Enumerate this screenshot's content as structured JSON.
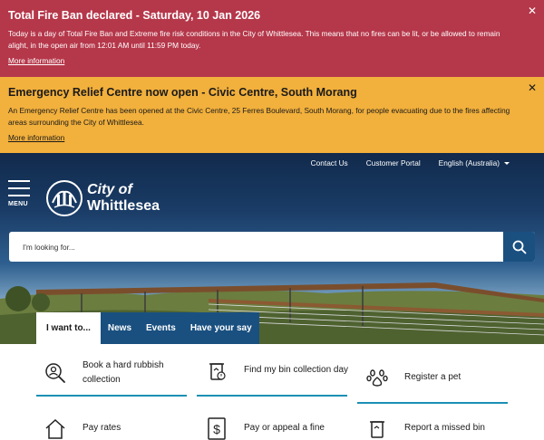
{
  "alerts": {
    "fire_ban": {
      "title": "Total Fire Ban declared - Saturday, 10 Jan 2026",
      "body": "Today is a day of Total Fire Ban and Extreme fire risk conditions in the City of Whittlesea. This means that no fires can be lit, or be allowed to remain alight, in the open air from 12:01 AM until 11:59 PM today.",
      "link": "More information",
      "close": "✕",
      "color": "#b5374a"
    },
    "relief_centre": {
      "title": "Emergency Relief Centre now open - Civic Centre, South Morang",
      "body": "An Emergency Relief Centre has been opened at the Civic Centre, 25 Ferres Boulevard, South Morang, for people evacuating due to the fires affecting areas surrounding the City of Whittlesea.",
      "link": "More information",
      "close": "✕",
      "color": "#f2b03c"
    }
  },
  "utility_nav": {
    "contact": "Contact Us",
    "portal": "Customer Portal",
    "language": "English (Australia)"
  },
  "header": {
    "menu_label": "MENU",
    "logo_line1": "City of",
    "logo_line2": "Whittlesea"
  },
  "search": {
    "placeholder": "I'm looking for...",
    "icon": "search-icon"
  },
  "tabs": [
    "I want to...",
    "News",
    "Events",
    "Have your say"
  ],
  "quick_links": {
    "hard_rubbish": "Book a hard rubbish collection",
    "bin_day": "Find my bin collection day",
    "register_pet": "Register a pet",
    "pay_rates": "Pay rates",
    "fine": "Pay or appeal a fine",
    "missed_bin": "Report a missed bin"
  },
  "colors": {
    "brand_blue": "#1a5080",
    "accent_teal": "#1a8fb3"
  }
}
